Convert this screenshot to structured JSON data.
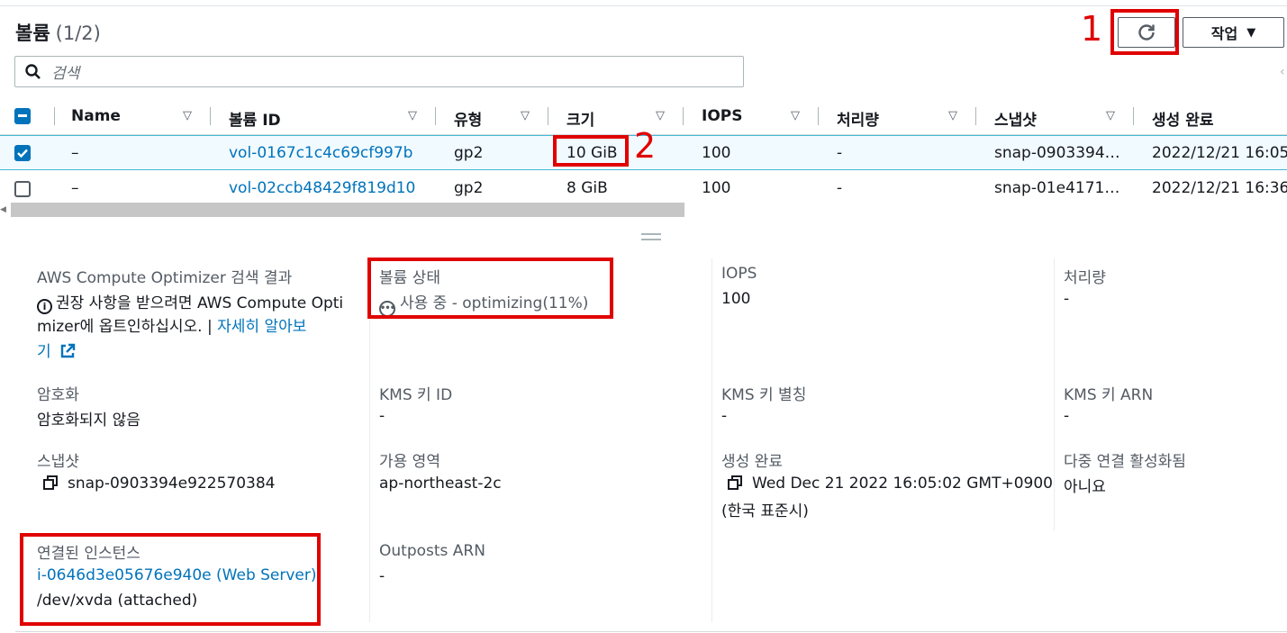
{
  "header": {
    "title": "볼륨",
    "count": "(1/2)",
    "refresh_icon": "refresh-icon",
    "actions_label": "작업",
    "actions_caret": "▼"
  },
  "search": {
    "placeholder": "검색"
  },
  "table": {
    "columns": [
      "Name",
      "볼륨 ID",
      "유형",
      "크기",
      "IOPS",
      "처리량",
      "스냅샷",
      "생성 완료"
    ],
    "rows": [
      {
        "selected": true,
        "name": "–",
        "volume_id": "vol-0167c1c4c69cf997b",
        "type": "gp2",
        "size": "10 GiB",
        "iops": "100",
        "throughput": "-",
        "snapshot": "snap-0903394…",
        "created": "2022/12/21 16:05"
      },
      {
        "selected": false,
        "name": "–",
        "volume_id": "vol-02ccb48429f819d10",
        "type": "gp2",
        "size": "8 GiB",
        "iops": "100",
        "throughput": "-",
        "snapshot": "snap-01e4171…",
        "created": "2022/12/21 16:36"
      }
    ]
  },
  "details": {
    "optimizer": {
      "label": "AWS Compute Optimizer 검색 결과",
      "line1": "권장 사항을 받으려면 AWS Compute Opti",
      "line2_prefix": "mizer에 옵트인하십시오. |",
      "link_part1": "자세히 알아보",
      "link_part2": "기"
    },
    "state": {
      "label": "볼륨 상태",
      "value": "사용 중 - optimizing(11%)"
    },
    "iops": {
      "label": "IOPS",
      "value": "100"
    },
    "throughput": {
      "label": "처리량",
      "value": "-"
    },
    "encryption": {
      "label": "암호화",
      "value": "암호화되지 않음"
    },
    "kms_id": {
      "label": "KMS 키 ID",
      "value": "-"
    },
    "kms_alias": {
      "label": "KMS 키 별칭",
      "value": "-"
    },
    "kms_arn": {
      "label": "KMS 키 ARN",
      "value": "-"
    },
    "snapshot": {
      "label": "스냅샷",
      "value": "snap-0903394e922570384"
    },
    "az": {
      "label": "가용 영역",
      "value": "ap-northeast-2c"
    },
    "created": {
      "label": "생성 완료",
      "value_line1": "Wed Dec 21 2022 16:05:02 GMT+0900",
      "value_line2": "(한국 표준시)"
    },
    "multi_attach": {
      "label": "다중 연결 활성화됨",
      "value": "아니요"
    },
    "attached": {
      "label": "연결된 인스턴스",
      "instance_link": "i-0646d3e05676e940e (Web Server)",
      "suffix": ":",
      "device": "/dev/xvda (attached)"
    },
    "outposts": {
      "label": "Outposts ARN",
      "value": "-"
    }
  },
  "annotations": {
    "one": "1",
    "two": "2"
  },
  "colors": {
    "link": "#0073bb",
    "highlight": "#e00000",
    "selected_row": "#f1faff"
  }
}
